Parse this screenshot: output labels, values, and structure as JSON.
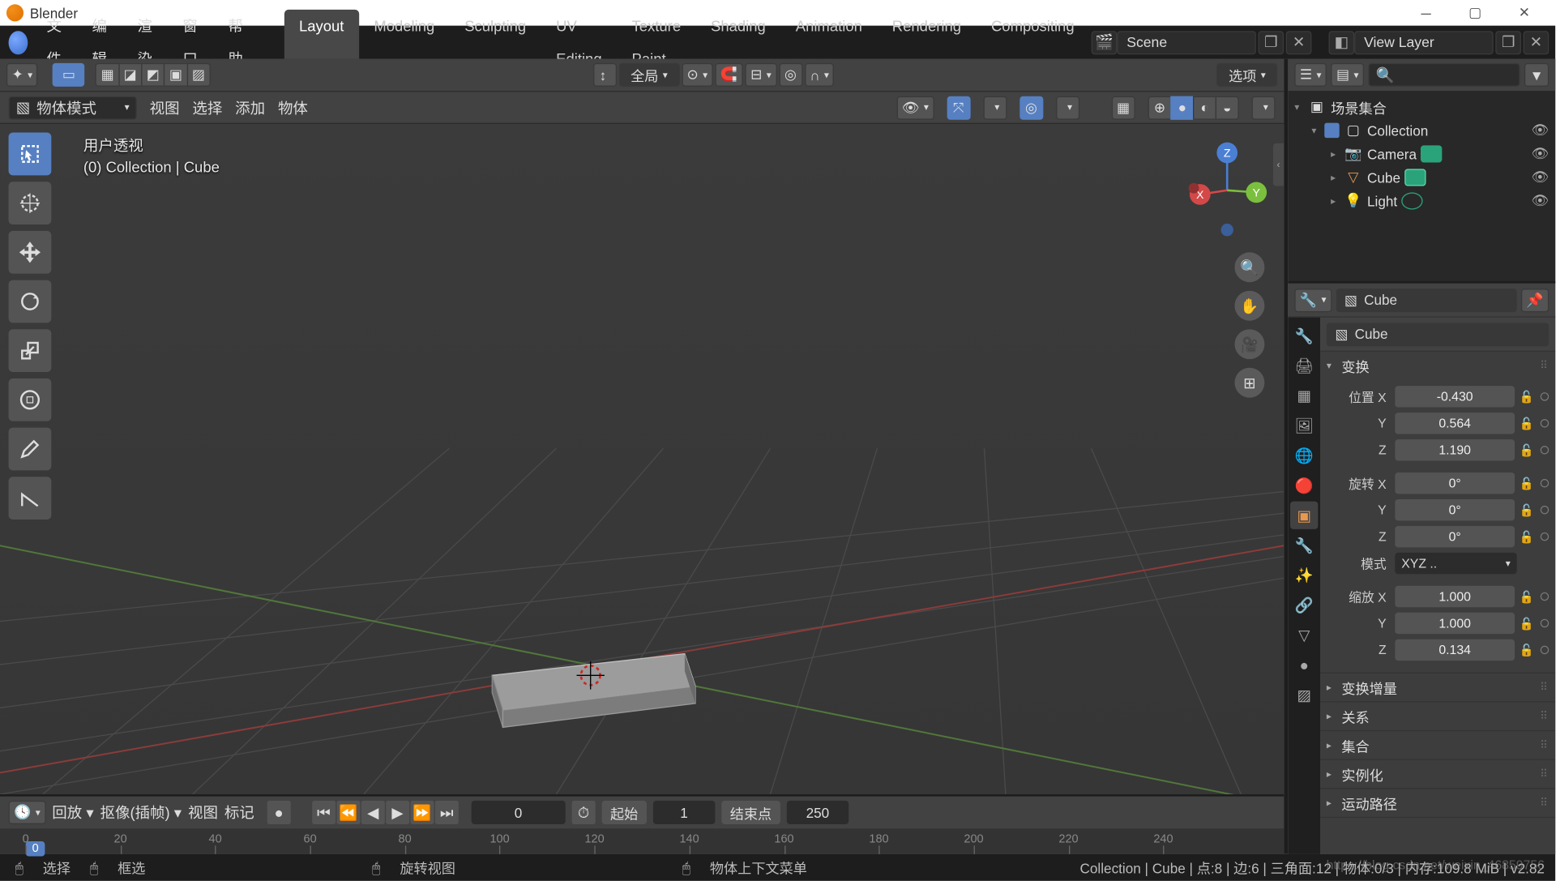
{
  "titlebar": {
    "app": "Blender"
  },
  "menu": {
    "file": "文件",
    "edit": "编辑",
    "render": "渲染",
    "window": "窗口",
    "help": "帮助"
  },
  "tabs": [
    "Layout",
    "Modeling",
    "Sculpting",
    "UV Editing",
    "Texture Paint",
    "Shading",
    "Animation",
    "Rendering",
    "Compositing"
  ],
  "active_tab": 0,
  "scene": {
    "label": "Scene",
    "viewlayer": "View Layer"
  },
  "viewport_header": {
    "orientation": "全局",
    "options": "选项"
  },
  "viewport_header2": {
    "mode": "物体模式",
    "view": "视图",
    "select": "选择",
    "add": "添加",
    "object": "物体"
  },
  "hud": {
    "line1": "用户透视",
    "line2": "(0) Collection | Cube"
  },
  "timeline": {
    "playback": "回放",
    "keying": "抠像(插帧)",
    "view": "视图",
    "marker": "标记",
    "current": 0,
    "start_lbl": "起始",
    "start": 1,
    "end_lbl": "结束点",
    "end": 250,
    "ticks": [
      0,
      20,
      40,
      60,
      80,
      100,
      120,
      140,
      160,
      180,
      200,
      220,
      240
    ]
  },
  "outliner": {
    "root": "场景集合",
    "collection": "Collection",
    "items": [
      {
        "name": "Camera",
        "icon": "camera",
        "tag": "#2aa37a"
      },
      {
        "name": "Cube",
        "icon": "mesh",
        "tag": "#2aa37a",
        "sel": true
      },
      {
        "name": "Light",
        "icon": "light",
        "tag": "#2aa37a"
      }
    ]
  },
  "props": {
    "pin_obj": "Cube",
    "breadcrumb": "Cube",
    "sections": {
      "transform": "变换",
      "loc": "位置",
      "rot": "旋转",
      "mode": "模式",
      "scale": "缩放",
      "mode_val": "XYZ ..",
      "delta": "变换增量",
      "relations": "关系",
      "collections": "集合",
      "instancing": "实例化",
      "motion": "运动路径"
    },
    "loc_x": "-0.430",
    "loc_y": "0.564",
    "loc_z": "1.190",
    "rot_x": "0°",
    "rot_y": "0°",
    "rot_z": "0°",
    "scale_x": "1.000",
    "scale_y": "1.000",
    "scale_z": "0.134"
  },
  "status": {
    "select": "选择",
    "box": "框选",
    "rotate": "旋转视图",
    "context": "物体上下文菜单",
    "right": "Collection | Cube | 点:8 | 边:6 | 三角面:12 | 物体:0/3 | 内存:109.8 MiB | v2.82"
  },
  "watermark": "https://blog.csdn.net/weixin_46859756"
}
